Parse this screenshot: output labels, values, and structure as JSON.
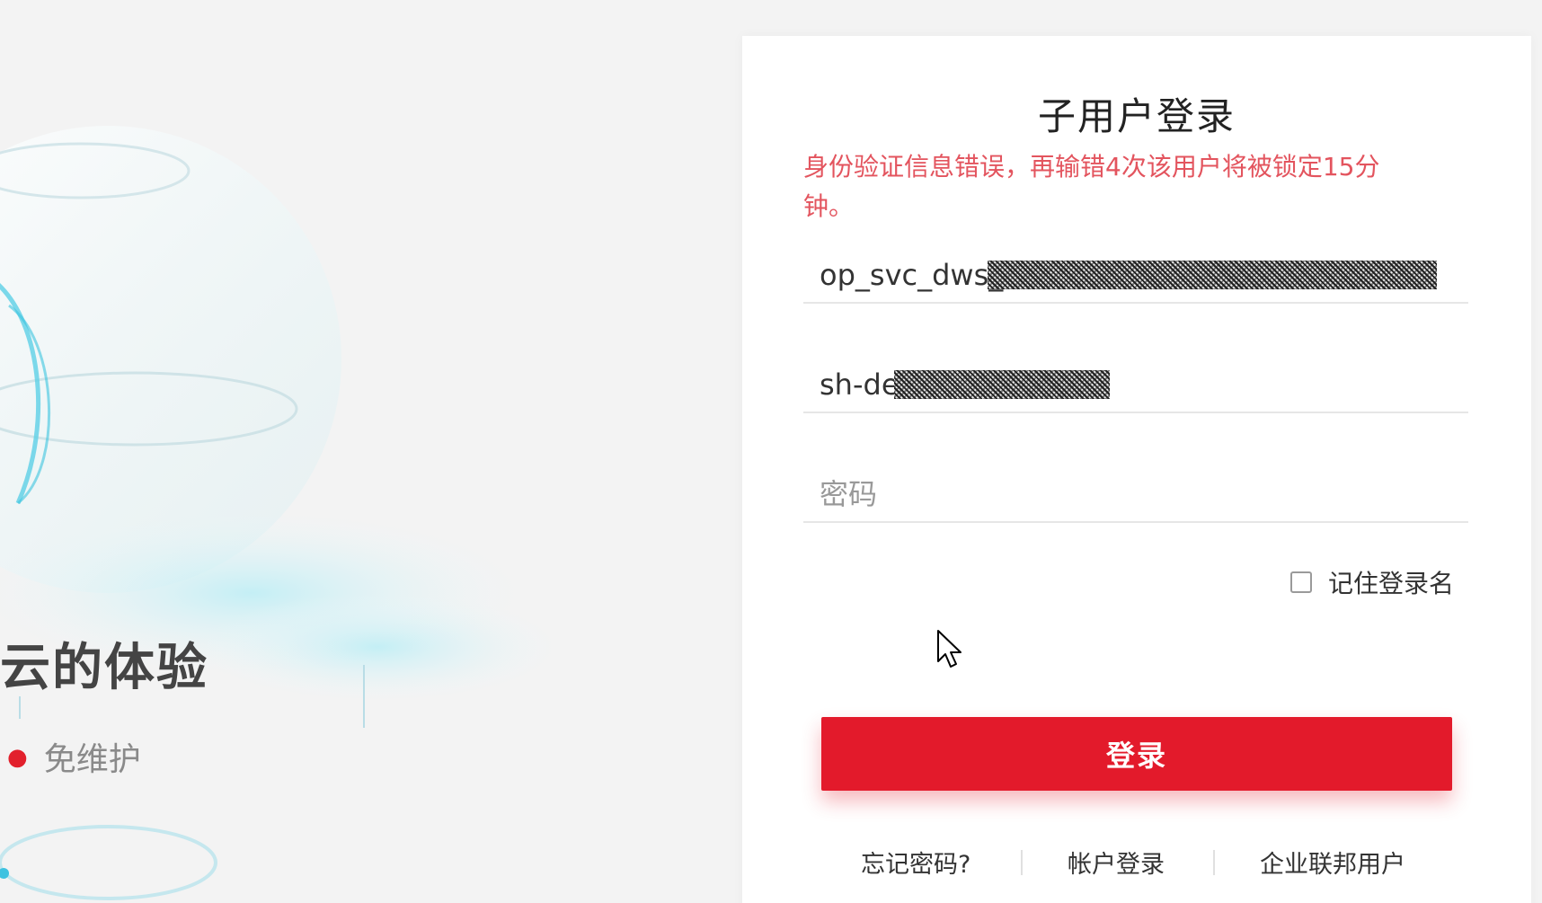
{
  "hero": {
    "title": "云的体验",
    "feature": "免维护"
  },
  "login": {
    "title": "子用户登录",
    "error": "身份验证信息错误，再输错4次该用户将被锁定15分钟。",
    "username_value": "op_svc_dws_ff",
    "domain_value": "sh-de",
    "password_placeholder": "密码",
    "remember_label": "记住登录名",
    "remember_checked": false,
    "submit_label": "登录"
  },
  "links": {
    "forgot_password": "忘记密码?",
    "account_login": "帐户登录",
    "federated_user": "企业联邦用户"
  },
  "colors": {
    "accent": "#e31a2b",
    "error": "#e3545e",
    "background": "#f3f3f3",
    "card": "#ffffff"
  }
}
